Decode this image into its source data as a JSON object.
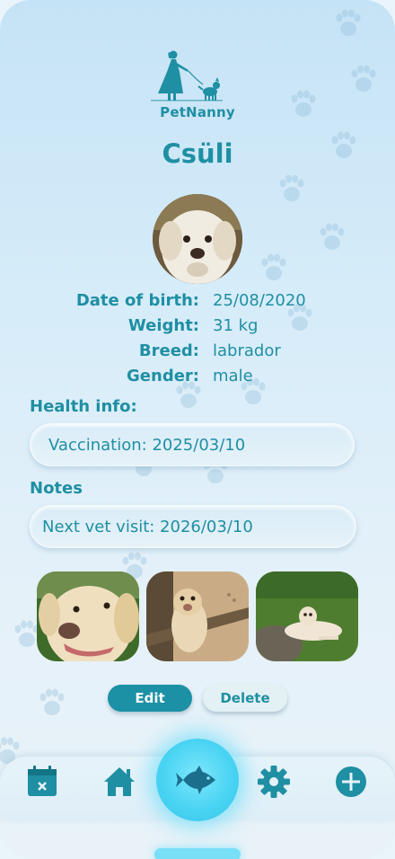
{
  "app": {
    "logo_text": "PetNanny"
  },
  "pet": {
    "name": "Csüli",
    "details": [
      {
        "label": "Date of birth:",
        "value": "25/08/2020"
      },
      {
        "label": "Weight:",
        "value": "31 kg"
      },
      {
        "label": "Breed:",
        "value": "labrador"
      },
      {
        "label": "Gender:",
        "value": "male"
      }
    ]
  },
  "health": {
    "title": "Health info:",
    "value": "Vaccination: 2025/03/10"
  },
  "notes": {
    "title": "Notes",
    "value": "Next vet visit: 2026/03/10"
  },
  "gallery": {
    "photos": [
      "dog-closeup-photo",
      "dog-sitting-photo",
      "dog-lying-grass-photo"
    ]
  },
  "actions": {
    "edit_label": "Edit",
    "delete_label": "Delete"
  },
  "nav": {
    "items": [
      "calendar-icon",
      "home-icon",
      "fish-icon",
      "settings-gear-icon",
      "plus-circle-icon"
    ]
  },
  "colors": {
    "accent": "#1f8fa3",
    "center_glow": "#4ad4f3",
    "background": "#d6ecf9"
  }
}
